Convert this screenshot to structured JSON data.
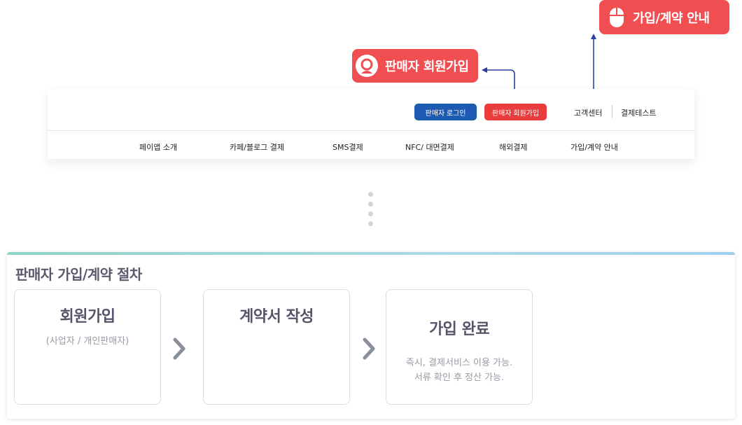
{
  "callouts": {
    "guide_label": "가입/계약 안내",
    "signup_label": "판매자 회원가입"
  },
  "header": {
    "login_button": "판매자 로그인",
    "signup_button": "판매자 회원가입",
    "customer_center": "고객센터",
    "payment_test": "결제테스트"
  },
  "nav": {
    "items": [
      "페이앱 소개",
      "카페/블로그 결제",
      "SMS결제",
      "NFC/ 대면결제",
      "해외결제",
      "가입/계약 안내"
    ]
  },
  "procedure": {
    "title": "판매자 가입/계약 절차",
    "steps": [
      {
        "title": "회원가입",
        "subtitle": "(사업자 / 개인판매자)"
      },
      {
        "title": "계약서 작성"
      },
      {
        "title": "가입 완료",
        "desc_line1": "즉시, 결제서비스 이용 가능.",
        "desc_line2": "서류 확인 후 정산 가능."
      }
    ]
  },
  "colors": {
    "callout_red": "#f04e51",
    "login_blue": "#1d5bb3",
    "signup_red": "#ea3c3c",
    "connector_blue": "#2a3fa0"
  },
  "icons": {
    "guide": "mouse-icon",
    "signup": "user-icon",
    "step_arrow": "chevron-right-icon"
  }
}
